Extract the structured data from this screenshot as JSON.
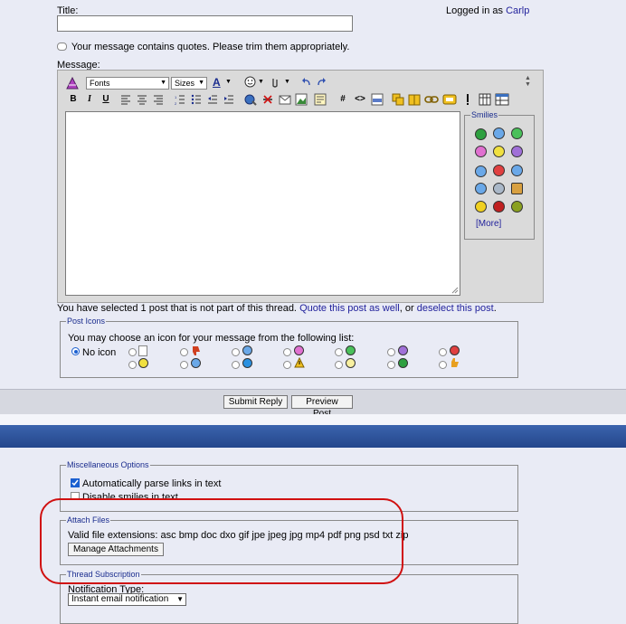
{
  "title_label": "Title:",
  "logged_in_prefix": "Logged in as",
  "logged_in_user": "Carlp",
  "quote_warning": "Your message contains quotes. Please trim them appropriately.",
  "message_label": "Message:",
  "editor": {
    "font_select": "Fonts",
    "size_select": "Sizes",
    "bold": "B",
    "italic": "I",
    "underline": "U",
    "hash": "#",
    "code": "<>",
    "smilies_legend": "Smilies",
    "more": "[More]"
  },
  "selection_text": "You have selected 1 post that is not part of this thread.",
  "quote_link": "Quote this post as well",
  "or_text": ", or",
  "deselect_link": "deselect this post",
  "period": ".",
  "post_icons": {
    "legend": "Post Icons",
    "instructions": "You may choose an icon for your message from the following list:",
    "no_icon": "No icon"
  },
  "buttons": {
    "submit": "Submit Reply",
    "preview": "Preview Post"
  },
  "misc": {
    "legend": "Miscellaneous Options",
    "parse_links": "Automatically parse links in text",
    "parse_links_checked": true,
    "disable_smilies": "Disable smilies in text"
  },
  "attach": {
    "legend": "Attach Files",
    "extensions": "Valid file extensions: asc bmp doc dxo gif jpe jpeg jpg mp4 pdf png psd txt zip",
    "manage_button": "Manage Attachments"
  },
  "subscription": {
    "legend": "Thread Subscription",
    "notification_label": "Notification Type:",
    "notification_value": "Instant email notification"
  },
  "colors": {
    "page_bg": "#e9ebf5",
    "link": "#22229c",
    "header_band": "#2a4f94",
    "highlight": "#d01010"
  }
}
